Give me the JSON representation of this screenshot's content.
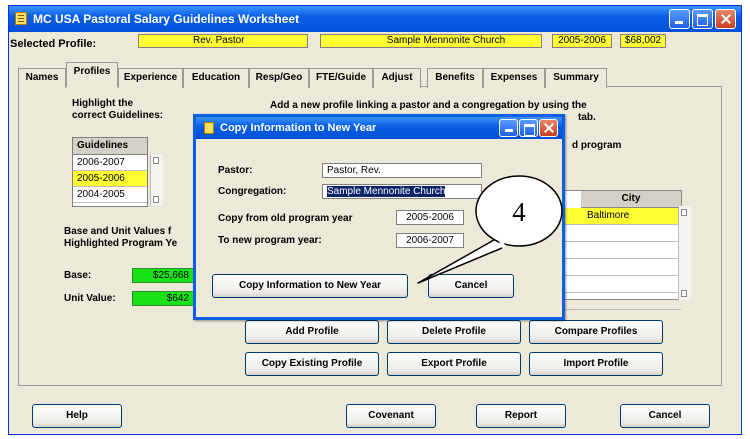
{
  "window": {
    "title": "MC USA Pastoral Salary Guidelines Worksheet"
  },
  "profile_bar": {
    "label": "Selected Profile:",
    "pastor": "Rev. Pastor",
    "church": "Sample Mennonite Church",
    "year": "2005-2006",
    "amount": "$68,002"
  },
  "tabs": [
    {
      "label": "Names"
    },
    {
      "label": "Profiles"
    },
    {
      "label": "Experience"
    },
    {
      "label": "Education"
    },
    {
      "label": "Resp/Geo"
    },
    {
      "label": "FTE/Guide"
    },
    {
      "label": "Adjust"
    },
    {
      "label": "Benefits"
    },
    {
      "label": "Expenses"
    },
    {
      "label": "Summary"
    }
  ],
  "profiles_panel": {
    "highlight_line1": "Highlight the",
    "highlight_line2": "correct Guidelines:",
    "add_line1": "Add a new profile linking a pastor and a congregation by using the",
    "add_line2_tail": "tab.",
    "program_tail": "d program",
    "guidelines_header": "Guidelines",
    "guidelines": [
      "2006-2007",
      "2005-2006",
      "2004-2005"
    ],
    "base_unit_line1": "Base and Unit Values f",
    "base_unit_line2": "Highlighted Program Ye",
    "base_label": "Base:",
    "base_value": "$25,668",
    "unit_label": "Unit Value:",
    "unit_value": "$642",
    "city_header": "City",
    "city_rows": [
      "Baltimore",
      "",
      "",
      "",
      "",
      ""
    ]
  },
  "profile_buttons": {
    "add": "Add Profile",
    "delete": "Delete Profile",
    "compare": "Compare Profiles",
    "copy": "Copy Existing Profile",
    "export": "Export Profile",
    "import": "Import Profile"
  },
  "bottom_buttons": {
    "help": "Help",
    "covenant": "Covenant",
    "report": "Report",
    "cancel": "Cancel"
  },
  "dialog": {
    "title": "Copy Information to New Year",
    "pastor_label": "Pastor:",
    "pastor_value": "Pastor, Rev.",
    "congregation_label": "Congregation:",
    "congregation_value": "Sample Mennonite Church",
    "from_label": "Copy from old program year",
    "from_value": "2005-2006",
    "to_label": "To new program year:",
    "to_value": "2006-2007",
    "copy_button": "Copy Information to New Year",
    "cancel_button": "Cancel"
  },
  "callout": {
    "number": "4"
  },
  "colors": {
    "highlight_yellow": "#ffff33",
    "value_green": "#19e219",
    "xp_blue": "#0a5fe5"
  }
}
